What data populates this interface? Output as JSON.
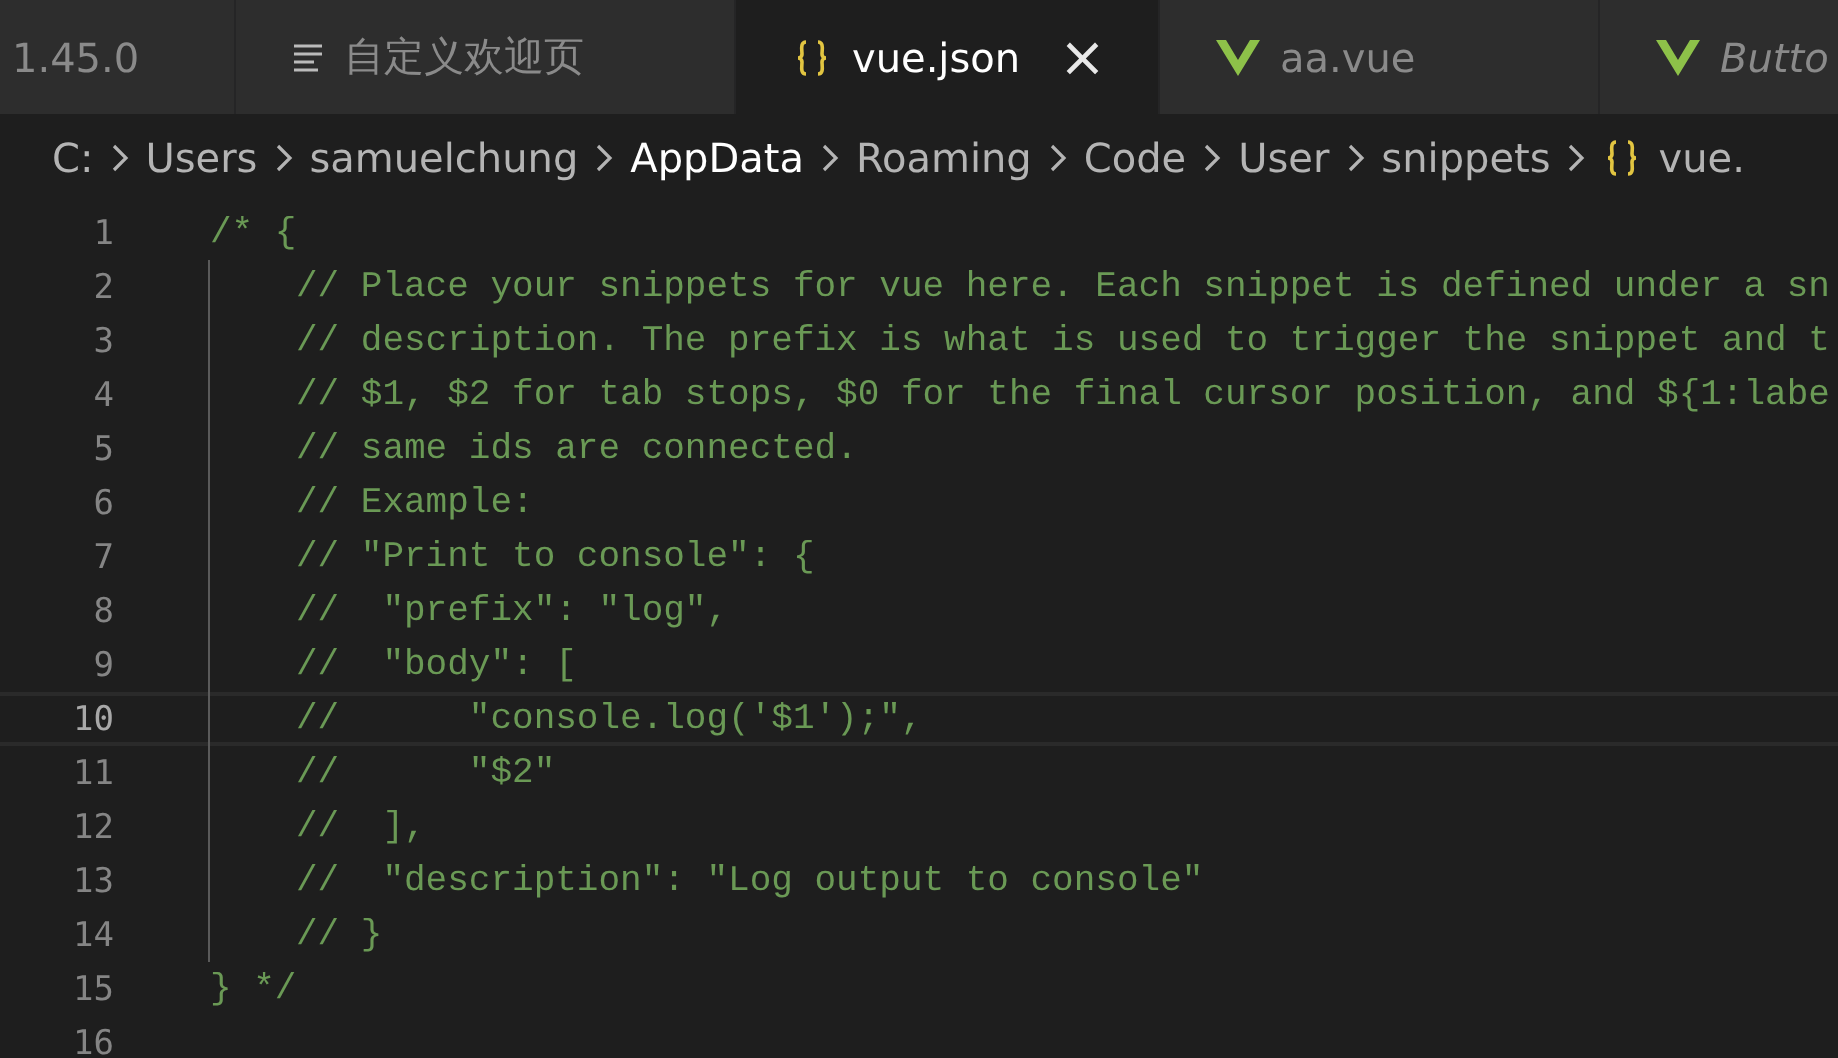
{
  "tabs": [
    {
      "label": "1.45.0",
      "kind": "plain",
      "selected": false,
      "italic": false
    },
    {
      "label": "自定义欢迎页",
      "kind": "preview",
      "selected": false,
      "italic": false
    },
    {
      "label": "vue.json",
      "kind": "json",
      "selected": true,
      "italic": false,
      "close": "×"
    },
    {
      "label": "aa.vue",
      "kind": "vue",
      "selected": false,
      "italic": false
    },
    {
      "label": "Butto",
      "kind": "vue",
      "selected": false,
      "italic": true
    }
  ],
  "breadcrumbs": [
    {
      "label": "C:",
      "selected": false,
      "kind": "folder"
    },
    {
      "label": "Users",
      "selected": false,
      "kind": "folder"
    },
    {
      "label": "samuelchung",
      "selected": false,
      "kind": "folder"
    },
    {
      "label": "AppData",
      "selected": true,
      "kind": "folder"
    },
    {
      "label": "Roaming",
      "selected": false,
      "kind": "folder"
    },
    {
      "label": "Code",
      "selected": false,
      "kind": "folder"
    },
    {
      "label": "User",
      "selected": false,
      "kind": "folder"
    },
    {
      "label": "snippets",
      "selected": false,
      "kind": "folder"
    },
    {
      "label": "vue.",
      "selected": false,
      "kind": "json"
    }
  ],
  "lines": [
    {
      "number": "1",
      "text": "/* {",
      "current": false,
      "children": [
        {
          "number": "2",
          "text": "// Place your snippets for vue here. Each snippet is defined under a sn",
          "current": false
        },
        {
          "number": "3",
          "text": "// description. The prefix is what is used to trigger the snippet and t",
          "current": false
        },
        {
          "number": "4",
          "text": "// $1, $2 for tab stops, $0 for the final cursor position, and ${1:labe",
          "current": false
        },
        {
          "number": "5",
          "text": "// same ids are connected.",
          "current": false
        },
        {
          "number": "6",
          "text": "// Example:",
          "current": false
        },
        {
          "number": "7",
          "text": "// \"Print to console\": {",
          "current": false
        },
        {
          "number": "8",
          "text": "//  \"prefix\": \"log\",",
          "current": false
        },
        {
          "number": "9",
          "text": "//  \"body\": [",
          "current": false
        },
        {
          "number": "10",
          "text": "//      \"console.log('$1');\",",
          "current": true
        },
        {
          "number": "11",
          "text": "//      \"$2\"",
          "current": false
        },
        {
          "number": "12",
          "text": "//  ],",
          "current": false
        },
        {
          "number": "13",
          "text": "//  \"description\": \"Log output to console\"",
          "current": false
        },
        {
          "number": "14",
          "text": "// }",
          "current": false
        }
      ]
    },
    {
      "number": "15",
      "text": "} */",
      "current": false
    },
    {
      "number": "16",
      "current": false
    }
  ]
}
